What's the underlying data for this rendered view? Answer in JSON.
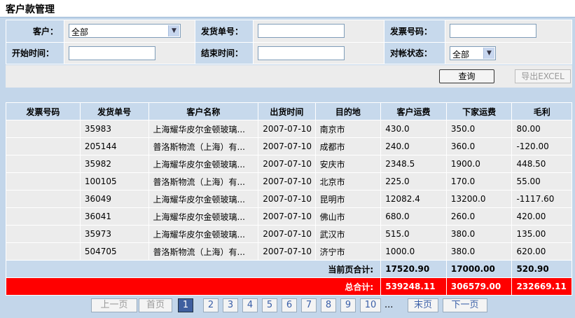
{
  "page": {
    "title": "客户款管理"
  },
  "filters": {
    "customer_label": "客户：",
    "customer_value": "全部",
    "ship_no_label": "发货单号：",
    "invoice_no_label": "发票号码：",
    "start_label": "开始时间：",
    "end_label": "结束时间：",
    "status_label": "对帐状态：",
    "status_value": "全部",
    "query_label": "查询",
    "export_label": "导出EXCEL"
  },
  "table": {
    "headers": [
      "发票号码",
      "发货单号",
      "客户名称",
      "出货时间",
      "目的地",
      "客户运费",
      "下家运费",
      "毛利"
    ],
    "rows": [
      {
        "invoice": "",
        "ship": "35983",
        "customer": "上海耀华皮尔金顿玻璃...",
        "date": "2007-07-10",
        "dest": "南京市",
        "cust_fee": "430.0",
        "next_fee": "350.0",
        "profit": "80.00"
      },
      {
        "invoice": "",
        "ship": "205144",
        "customer": "普洛斯物流（上海）有...",
        "date": "2007-07-10",
        "dest": "成都市",
        "cust_fee": "240.0",
        "next_fee": "360.0",
        "profit": "-120.00"
      },
      {
        "invoice": "",
        "ship": "35982",
        "customer": "上海耀华皮尔金顿玻璃...",
        "date": "2007-07-10",
        "dest": "安庆市",
        "cust_fee": "2348.5",
        "next_fee": "1900.0",
        "profit": "448.50"
      },
      {
        "invoice": "",
        "ship": "100105",
        "customer": "普洛斯物流（上海）有...",
        "date": "2007-07-10",
        "dest": "北京市",
        "cust_fee": "225.0",
        "next_fee": "170.0",
        "profit": "55.00"
      },
      {
        "invoice": "",
        "ship": "36049",
        "customer": "上海耀华皮尔金顿玻璃...",
        "date": "2007-07-10",
        "dest": "昆明市",
        "cust_fee": "12082.4",
        "next_fee": "13200.0",
        "profit": "-1117.60"
      },
      {
        "invoice": "",
        "ship": "36041",
        "customer": "上海耀华皮尔金顿玻璃...",
        "date": "2007-07-10",
        "dest": "佛山市",
        "cust_fee": "680.0",
        "next_fee": "260.0",
        "profit": "420.00"
      },
      {
        "invoice": "",
        "ship": "35973",
        "customer": "上海耀华皮尔金顿玻璃...",
        "date": "2007-07-10",
        "dest": "武汉市",
        "cust_fee": "515.0",
        "next_fee": "380.0",
        "profit": "135.00"
      },
      {
        "invoice": "",
        "ship": "504705",
        "customer": "普洛斯物流（上海）有...",
        "date": "2007-07-10",
        "dest": "济宁市",
        "cust_fee": "1000.0",
        "next_fee": "380.0",
        "profit": "620.00"
      }
    ],
    "subtotal_label": "当前页合计:",
    "subtotal_cust": "17520.90",
    "subtotal_next": "17000.00",
    "subtotal_profit": "520.90",
    "total_label": "总合计:",
    "total_cust": "539248.11",
    "total_next": "306579.00",
    "total_profit": "232669.11"
  },
  "pager": {
    "prev": "上一页",
    "first": "首页",
    "pages": [
      "1",
      "2",
      "3",
      "4",
      "5",
      "6",
      "7",
      "8",
      "9",
      "10"
    ],
    "dots": "...",
    "last": "末页",
    "next": "下一页"
  }
}
